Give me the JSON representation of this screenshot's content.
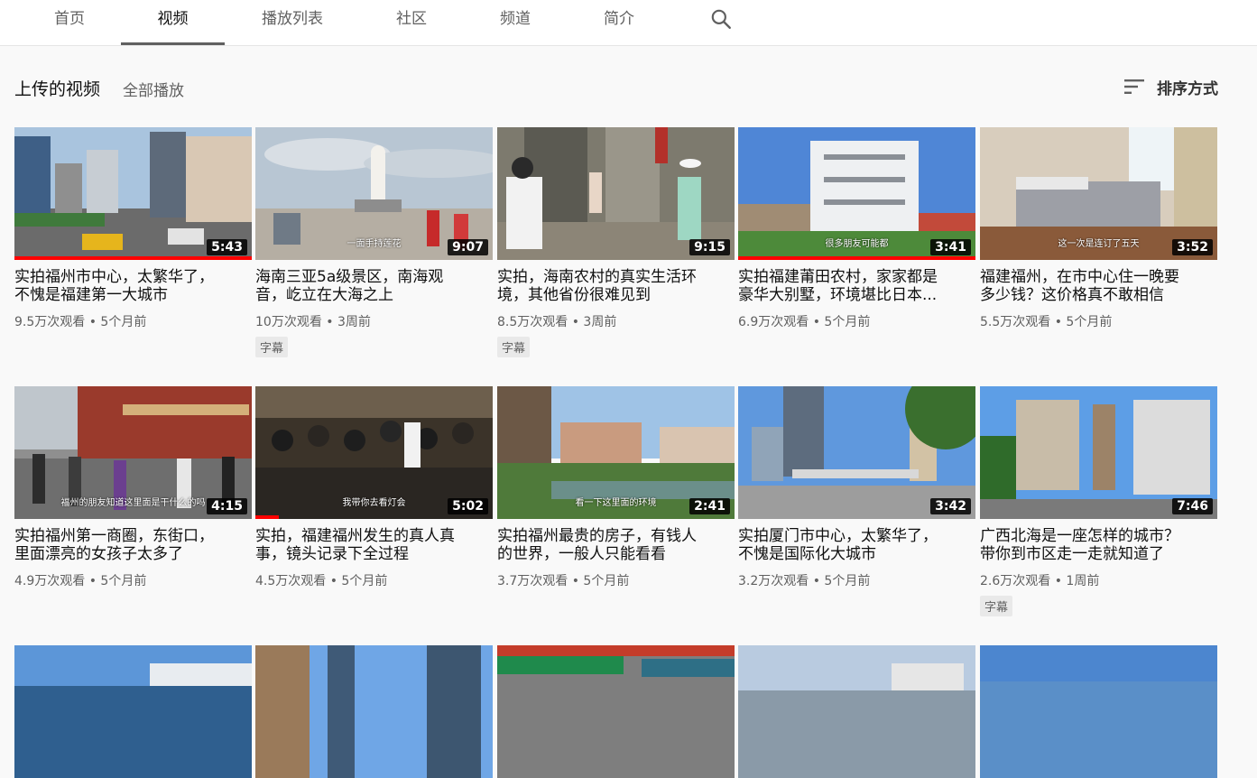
{
  "tabs": [
    {
      "label": "首页"
    },
    {
      "label": "视频"
    },
    {
      "label": "播放列表"
    },
    {
      "label": "社区"
    },
    {
      "label": "频道"
    },
    {
      "label": "简介"
    }
  ],
  "active_tab": "视频",
  "search_icon": "search-icon",
  "section": {
    "title": "上传的视频",
    "play_all": "全部播放",
    "sort_label": "排序方式",
    "sort_icon": "sort-icon"
  },
  "colors": {
    "progress": "#ff0000",
    "badge_bg": "#e9e9e9"
  },
  "videos": [
    {
      "title": "实拍福州市中心，太繁华了，\n不愧是福建第一大城市",
      "meta": "9.5万次观看 • 5个月前",
      "duration": "5:43",
      "progress": 1.0,
      "caption": "",
      "badge": ""
    },
    {
      "title": "海南三亚5a级景区，南海观\n音，屹立在大海之上",
      "meta": "10万次观看 • 3周前",
      "duration": "9:07",
      "progress": 0,
      "caption": "一面手持莲花",
      "badge": "字幕"
    },
    {
      "title": "实拍，海南农村的真实生活环\n境，其他省份很难见到",
      "meta": "8.5万次观看 • 3周前",
      "duration": "9:15",
      "progress": 0,
      "caption": "",
      "badge": "字幕"
    },
    {
      "title": "实拍福建莆田农村，家家都是\n豪华大别墅，环境堪比日本...",
      "meta": "6.9万次观看 • 5个月前",
      "duration": "3:41",
      "progress": 1.0,
      "caption": "很多朋友可能都",
      "badge": ""
    },
    {
      "title": "福建福州，在市中心住一晚要\n多少钱？这价格真不敢相信",
      "meta": "5.5万次观看 • 5个月前",
      "duration": "3:52",
      "progress": 0,
      "caption": "这一次是连订了五天",
      "badge": ""
    },
    {
      "title": "实拍福州第一商圈，东街口，\n里面漂亮的女孩子太多了",
      "meta": "4.9万次观看 • 5个月前",
      "duration": "4:15",
      "progress": 0,
      "caption": "福州的朋友知道这里面是干什么的吗",
      "badge": ""
    },
    {
      "title": "实拍，福建福州发生的真人真\n事，镜头记录下全过程",
      "meta": "4.5万次观看 • 5个月前",
      "duration": "5:02",
      "progress": 0.1,
      "caption": "我带你去看灯会",
      "badge": ""
    },
    {
      "title": "实拍福州最贵的房子，有钱人\n的世界，一般人只能看看",
      "meta": "3.7万次观看 • 5个月前",
      "duration": "2:41",
      "progress": 0,
      "caption": "看一下这里面的环境",
      "badge": ""
    },
    {
      "title": "实拍厦门市中心，太繁华了，\n不愧是国际化大城市",
      "meta": "3.2万次观看 • 5个月前",
      "duration": "3:42",
      "progress": 0,
      "caption": "",
      "badge": ""
    },
    {
      "title": "广西北海是一座怎样的城市？\n带你到市区走一走就知道了",
      "meta": "2.6万次观看 • 1周前",
      "duration": "7:46",
      "progress": 0,
      "caption": "",
      "badge": "字幕"
    }
  ]
}
